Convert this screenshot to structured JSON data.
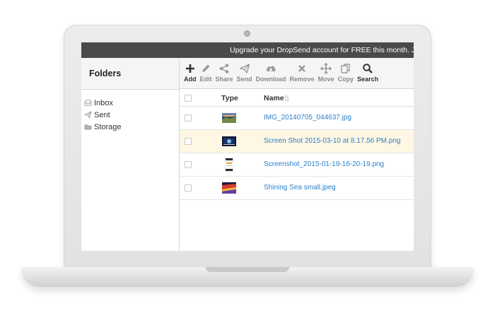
{
  "banner": {
    "text": "Upgrade your DropSend account for  FREE  this month. Just u"
  },
  "folders": {
    "title": "Folders",
    "items": [
      {
        "label": "Inbox",
        "icon": "inbox-icon"
      },
      {
        "label": "Sent",
        "icon": "send-icon"
      },
      {
        "label": "Storage",
        "icon": "folder-icon"
      }
    ]
  },
  "toolbar": {
    "items": [
      {
        "label": "Add",
        "icon": "plus-icon"
      },
      {
        "label": "Edit",
        "icon": "pencil-icon"
      },
      {
        "label": "Share",
        "icon": "share-icon"
      },
      {
        "label": "Send",
        "icon": "paper-plane-icon"
      },
      {
        "label": "Download",
        "icon": "cloud-download-icon"
      },
      {
        "label": "Remove",
        "icon": "x-icon"
      },
      {
        "label": "Move",
        "icon": "move-arrows-icon"
      },
      {
        "label": "Copy",
        "icon": "copy-icon"
      },
      {
        "label": "Search",
        "icon": "search-icon"
      }
    ]
  },
  "table": {
    "col_type": "Type",
    "col_name": "Name",
    "rows": [
      {
        "name": "IMG_20140705_044637.jpg",
        "selected": false
      },
      {
        "name": "Screen Shot 2015-03-10 at 8.17.56 PM.png",
        "selected": true
      },
      {
        "name": "Screenshot_2015-01-19-16-20-19.png",
        "selected": false
      },
      {
        "name": "Shining Sea small.jpeg",
        "selected": false
      }
    ]
  },
  "colors": {
    "banner_bg": "#4a4a4a",
    "link": "#2d7fc9",
    "selected_row": "#fdf7e3",
    "toolbar_bg": "#f5f5f5"
  }
}
